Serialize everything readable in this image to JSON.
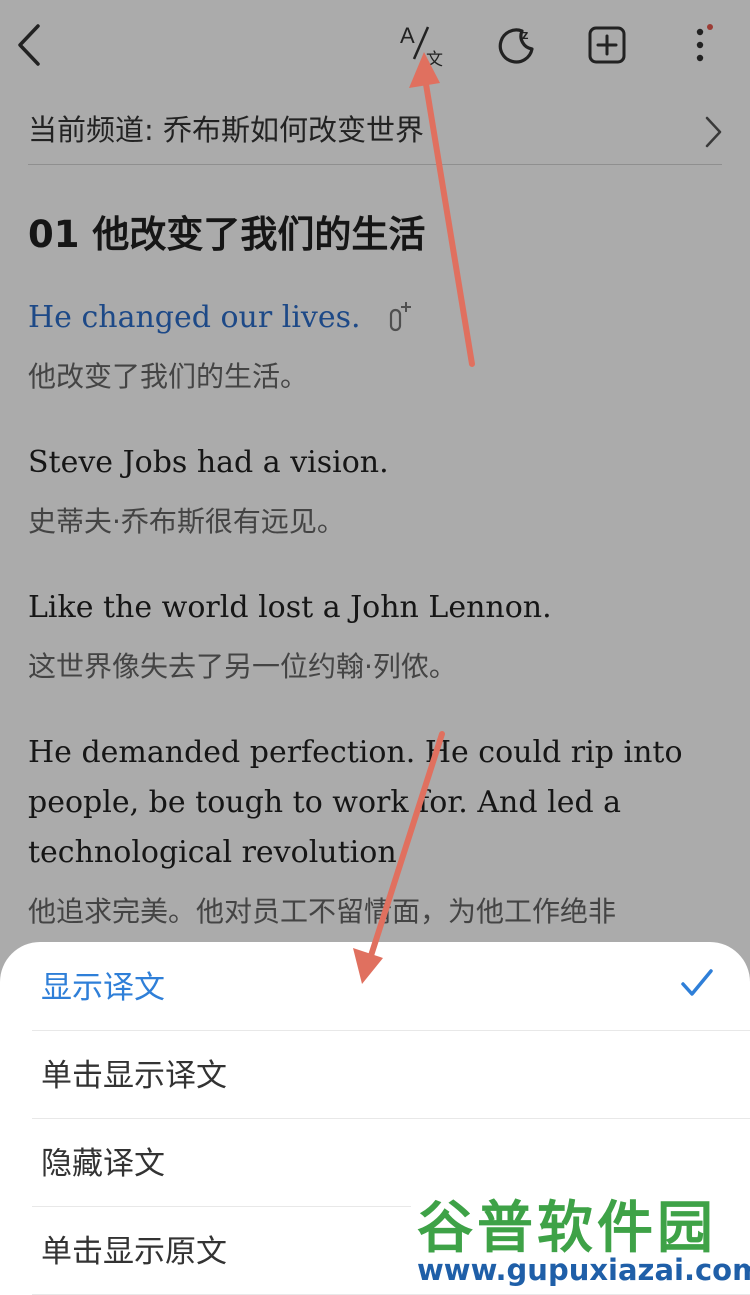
{
  "channel": {
    "label": "当前频道: 乔布斯如何改变世界"
  },
  "lesson": {
    "title": "01 他改变了我们的生活"
  },
  "sentences": [
    {
      "en": "He changed our lives.",
      "zh": "他改变了我们的生活。"
    },
    {
      "en": "Steve Jobs had a vision.",
      "zh": "史蒂夫·乔布斯很有远见。"
    },
    {
      "en": "Like the world lost a John Lennon.",
      "zh": "这世界像失去了另一位约翰·列侬。"
    },
    {
      "en_lines": [
        "He demanded perfection. He could rip into",
        "people, be tough to work for. And led a",
        "technological revolution."
      ],
      "zh": "他追求完美。他对员工不留情面，为他工作绝非"
    }
  ],
  "toolbar": {
    "icons": [
      "back-arrow-icon",
      "translate-icon",
      "night-mode-icon",
      "add-icon",
      "more-icon"
    ]
  },
  "sheet": {
    "options": [
      {
        "label": "显示译文",
        "selected": true
      },
      {
        "label": "单击显示译文",
        "selected": false
      },
      {
        "label": "隐藏译文",
        "selected": false
      },
      {
        "label": "单击显示原文",
        "selected": false
      }
    ]
  },
  "watermark": {
    "cn": "谷普软件园",
    "url": "www.gupuxiazai.com"
  },
  "colors": {
    "accent": "#2f7fd8",
    "highlight_text": "#2c6dc9",
    "arrow": "#e0705f",
    "watermark_green": "#3ea247",
    "watermark_blue": "#1f5fa8"
  }
}
